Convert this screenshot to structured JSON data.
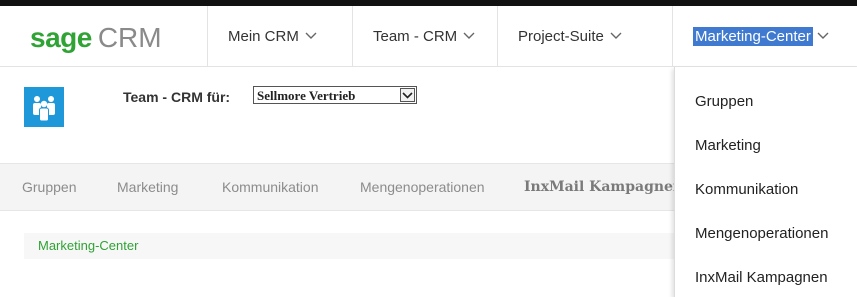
{
  "logo": {
    "sage": "sage",
    "crm": "CRM"
  },
  "nav": {
    "items": [
      {
        "label": "Mein CRM"
      },
      {
        "label": "Team - CRM"
      },
      {
        "label": "Project-Suite"
      },
      {
        "label": "Marketing-Center"
      }
    ]
  },
  "team": {
    "label": "Team - CRM für:",
    "select_value": "Sellmore Vertrieb"
  },
  "tabs": [
    {
      "label": "Gruppen"
    },
    {
      "label": "Marketing"
    },
    {
      "label": "Kommunikation"
    },
    {
      "label": "Mengenoperationen"
    },
    {
      "label": "InxMail Kampagnen"
    }
  ],
  "content": {
    "breadcrumb": "Marketing-Center"
  },
  "dropdown": {
    "items": [
      {
        "label": "Gruppen"
      },
      {
        "label": "Marketing"
      },
      {
        "label": "Kommunikation"
      },
      {
        "label": "Mengenoperationen"
      },
      {
        "label": "InxMail Kampagnen"
      }
    ]
  },
  "colors": {
    "brand_green": "#2fa334",
    "selection_blue": "#3f7ad0",
    "team_icon_blue": "#1e98d8"
  }
}
